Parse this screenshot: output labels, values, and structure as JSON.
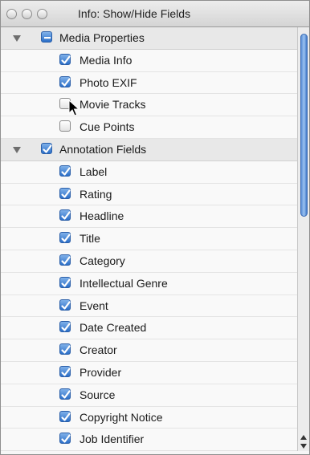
{
  "window": {
    "title": "Info: Show/Hide Fields"
  },
  "groups": [
    {
      "label": "Media Properties",
      "state": "mixed",
      "items": [
        {
          "label": "Media Info",
          "checked": true
        },
        {
          "label": "Photo EXIF",
          "checked": true
        },
        {
          "label": "Movie Tracks",
          "checked": false
        },
        {
          "label": "Cue Points",
          "checked": false
        }
      ]
    },
    {
      "label": "Annotation Fields",
      "state": "checked",
      "items": [
        {
          "label": "Label",
          "checked": true
        },
        {
          "label": "Rating",
          "checked": true
        },
        {
          "label": "Headline",
          "checked": true
        },
        {
          "label": "Title",
          "checked": true
        },
        {
          "label": "Category",
          "checked": true
        },
        {
          "label": "Intellectual Genre",
          "checked": true
        },
        {
          "label": "Event",
          "checked": true
        },
        {
          "label": "Date Created",
          "checked": true
        },
        {
          "label": "Creator",
          "checked": true
        },
        {
          "label": "Provider",
          "checked": true
        },
        {
          "label": "Source",
          "checked": true
        },
        {
          "label": "Copyright Notice",
          "checked": true
        },
        {
          "label": "Job Identifier",
          "checked": true
        }
      ]
    }
  ],
  "colors": {
    "checkbox_blue": "#2b6fc8",
    "scroll_thumb": "#5a8fd6"
  }
}
